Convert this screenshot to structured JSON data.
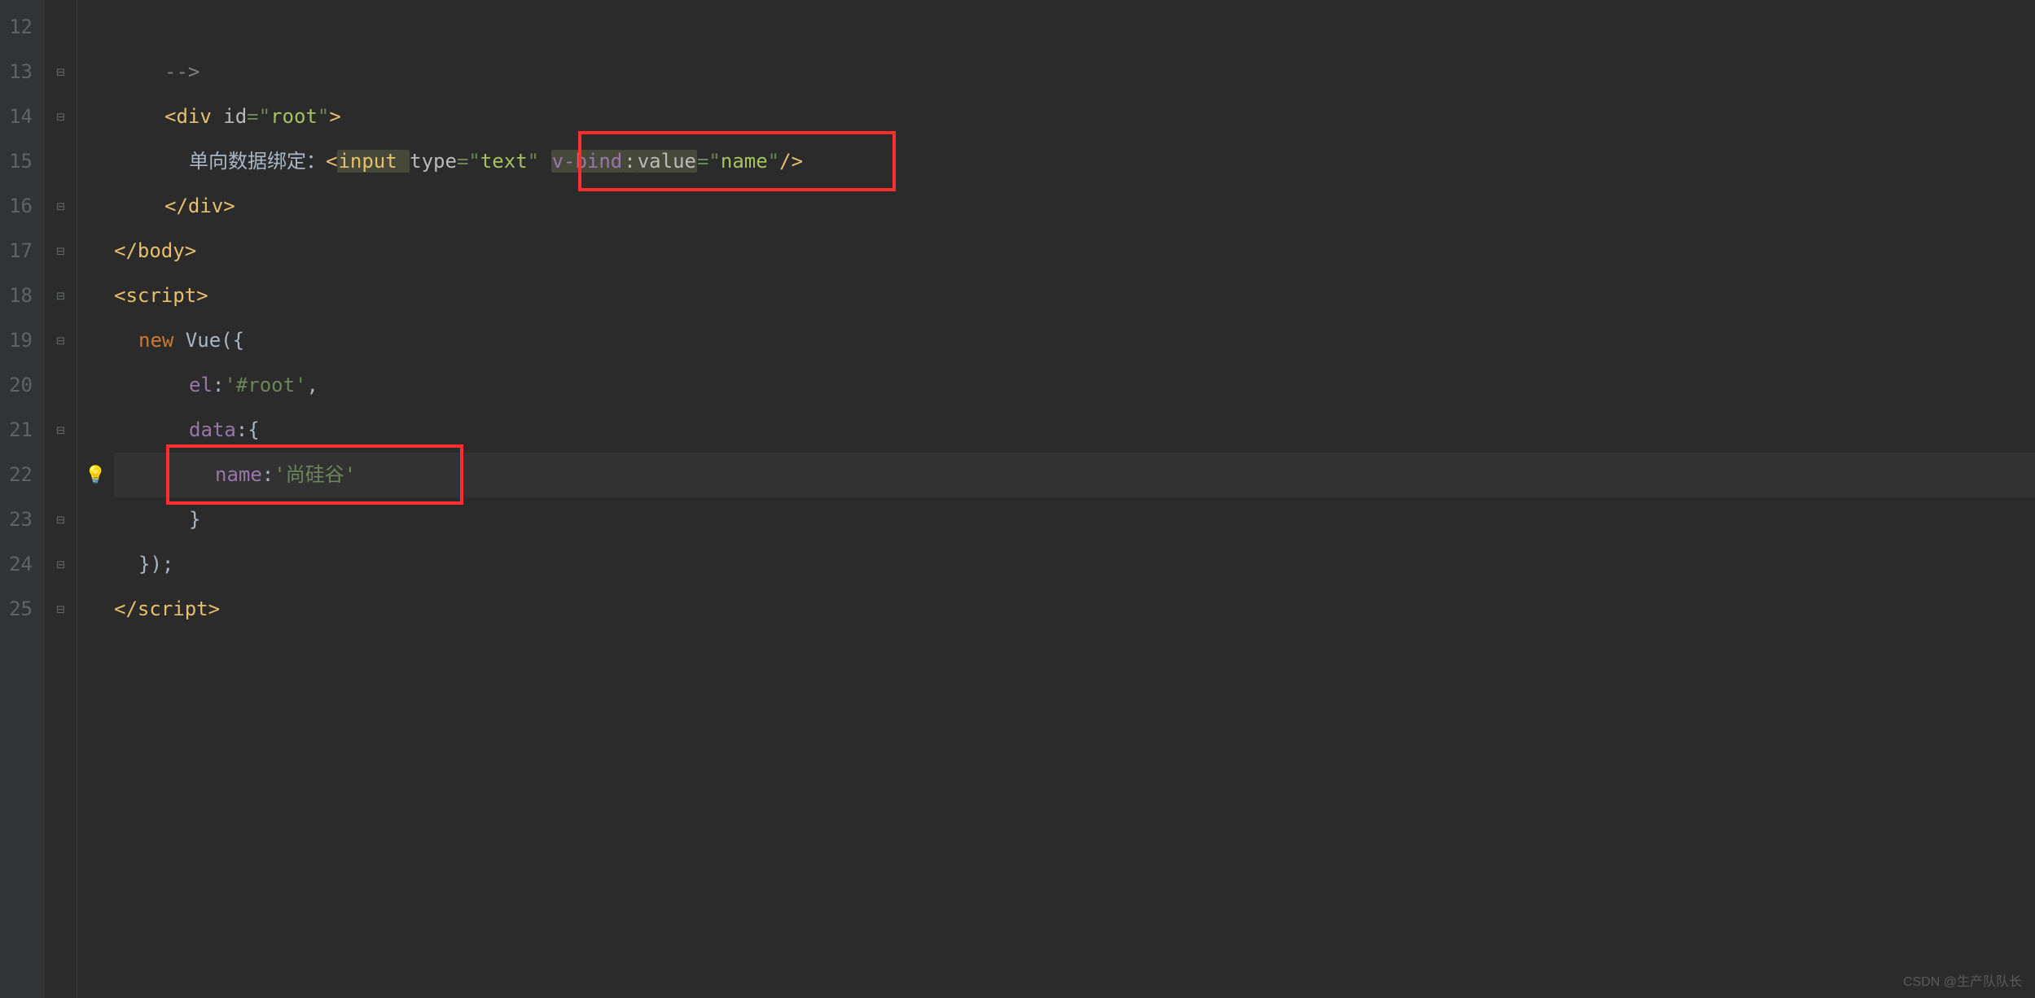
{
  "watermark": "CSDN @生产队队长",
  "gutter": {
    "start": 12,
    "count": 14
  },
  "fold": [
    "",
    "⊟",
    "⊟",
    "",
    "⊟",
    "⊟",
    "⊟",
    "⊟",
    "",
    "⊟",
    "",
    "⊟",
    "⊟",
    "⊟"
  ],
  "hint": [
    "",
    "",
    "",
    "",
    "",
    "",
    "",
    "",
    "",
    "",
    "bulb",
    "",
    "",
    ""
  ],
  "lines": {
    "l12": "",
    "l13": {
      "text": "-->"
    },
    "l14": {
      "lt": "<",
      "tag": "div ",
      "attr": "id",
      "eq": "=",
      "q": "\"",
      "val": "root",
      "gt": ">"
    },
    "l15": {
      "pre": "单向数据绑定：",
      "lt": "<",
      "tag": "input ",
      "attr1": "type",
      "eq1": "=",
      "q": "\"",
      "val1": "text",
      "sp": " ",
      "ns": "v-bind",
      "colon": ":",
      "attr2": "value",
      "eq2": "=",
      "val2": "name",
      "close": "/>"
    },
    "l16": {
      "lt": "</",
      "tag": "div",
      "gt": ">"
    },
    "l17": {
      "lt": "</",
      "tag": "body",
      "gt": ">"
    },
    "l18": {
      "lt": "<",
      "tag": "script",
      "gt": ">"
    },
    "l19": {
      "kw": "new ",
      "id": "Vue",
      "paren": "({"
    },
    "l20": {
      "prop": "el",
      "colon": ":",
      "val": "'#root'",
      "comma": ","
    },
    "l21": {
      "prop": "data",
      "colon": ":",
      "brace": "{"
    },
    "l22": {
      "prop": "name",
      "colon": ":",
      "val": "'尚硅谷'"
    },
    "l23": {
      "brace": "}"
    },
    "l24": {
      "close": "});"
    },
    "l25": {
      "lt": "</",
      "tag": "script",
      "gt": ">"
    }
  }
}
